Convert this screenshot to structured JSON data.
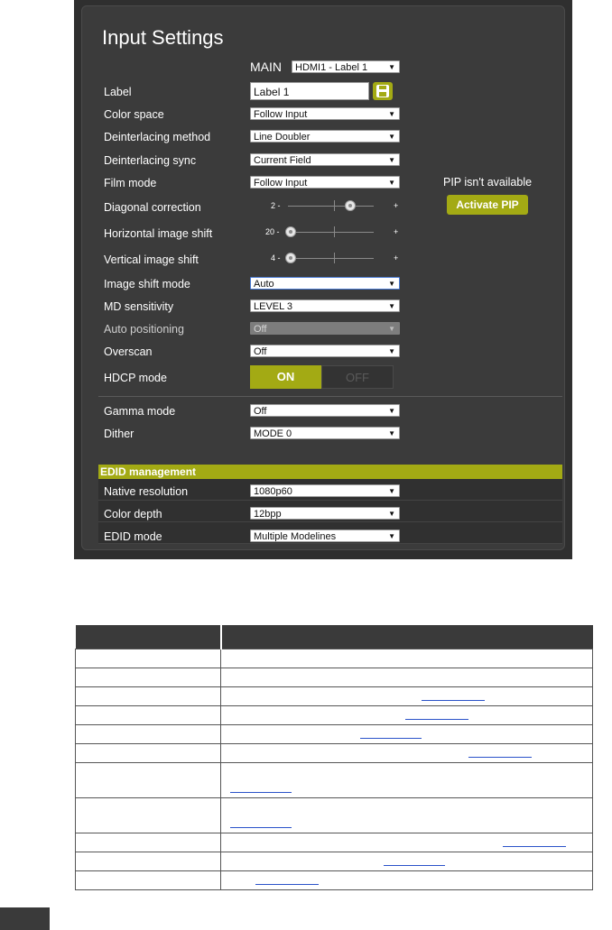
{
  "panel": {
    "title": "Input Settings",
    "main": {
      "label": "MAIN",
      "value": "HDMI1 - Label 1"
    },
    "rows": [
      {
        "label": "Label",
        "value": "Label 1"
      },
      {
        "label": "Color space",
        "value": "Follow Input"
      },
      {
        "label": "Deinterlacing method",
        "value": "Line Doubler"
      },
      {
        "label": "Deinterlacing sync",
        "value": "Current Field"
      },
      {
        "label": "Film mode",
        "value": "Follow Input"
      },
      {
        "label": "Diagonal correction",
        "value": "2 -",
        "plus": "+"
      },
      {
        "label": "Horizontal image shift",
        "value": "20 -",
        "plus": "+"
      },
      {
        "label": "Vertical image shift",
        "value": "4 -",
        "plus": "+"
      },
      {
        "label": "Image shift mode",
        "value": "Auto"
      },
      {
        "label": "MD sensitivity",
        "value": "LEVEL 3"
      },
      {
        "label": "Auto positioning",
        "value": "Off"
      },
      {
        "label": "Overscan",
        "value": "Off"
      },
      {
        "label": "HDCP mode",
        "on": "ON",
        "off": "OFF"
      },
      {
        "label": "Gamma mode",
        "value": "Off"
      },
      {
        "label": "Dither",
        "value": "MODE 0"
      }
    ],
    "pip": {
      "status": "PIP isn't available",
      "button": "Activate PIP"
    },
    "edid": {
      "header": "EDID management",
      "rows": [
        {
          "label": "Native resolution",
          "value": "1080p60"
        },
        {
          "label": "Color depth",
          "value": "12bpp"
        },
        {
          "label": "EDID mode",
          "value": "Multiple Modelines"
        }
      ]
    },
    "arrow_glyph": "▼"
  },
  "colors": {
    "accent": "#a3aa14",
    "panel_bg": "#3b3b3b"
  }
}
